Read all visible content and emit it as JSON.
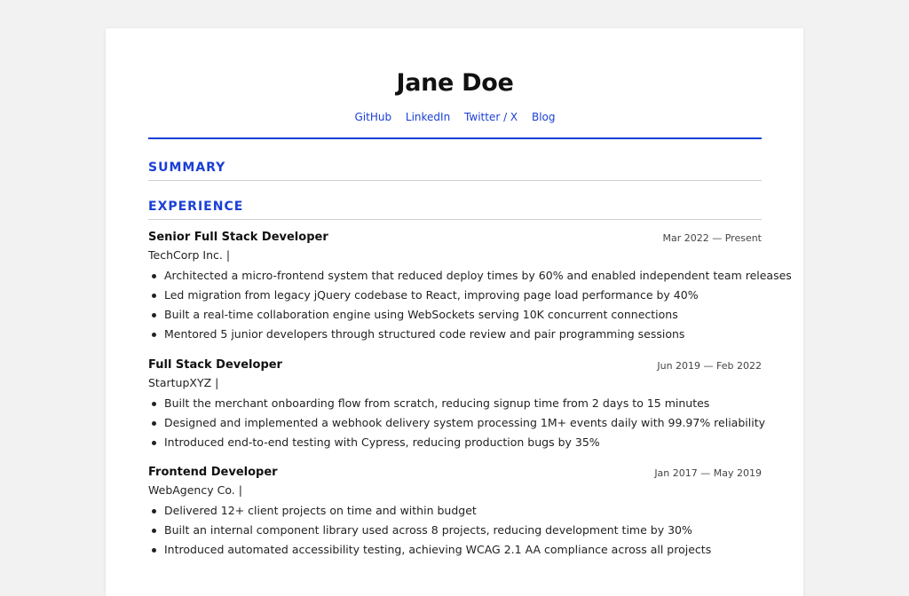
{
  "header": {
    "name": "Jane Doe",
    "links": [
      "GitHub",
      "LinkedIn",
      "Twitter / X",
      "Blog"
    ]
  },
  "sections": {
    "summary": "SUMMARY",
    "experience": "EXPERIENCE"
  },
  "jobs": [
    {
      "title": "Senior Full Stack Developer",
      "company": "TechCorp Inc. |",
      "dates": "Mar 2022 — Present",
      "bullets": [
        "Architected a micro-frontend system that reduced deploy times by 60% and enabled independent team releases",
        "Led migration from legacy jQuery codebase to React, improving page load performance by 40%",
        "Built a real-time collaboration engine using WebSockets serving 10K concurrent connections",
        "Mentored 5 junior developers through structured code review and pair programming sessions"
      ]
    },
    {
      "title": "Full Stack Developer",
      "company": "StartupXYZ |",
      "dates": "Jun 2019 — Feb 2022",
      "bullets": [
        "Built the merchant onboarding flow from scratch, reducing signup time from 2 days to 15 minutes",
        "Designed and implemented a webhook delivery system processing 1M+ events daily with 99.97% reliability",
        "Introduced end-to-end testing with Cypress, reducing production bugs by 35%"
      ]
    },
    {
      "title": "Frontend Developer",
      "company": "WebAgency Co. |",
      "dates": "Jan 2017 — May 2019",
      "bullets": [
        "Delivered 12+ client projects on time and within budget",
        "Built an internal component library used across 8 projects, reducing development time by 30%",
        "Introduced automated accessibility testing, achieving WCAG 2.1 AA compliance across all projects"
      ]
    }
  ],
  "colors": {
    "accent": "#1a3fd6",
    "background": "#f2f2f2",
    "paper": "#ffffff"
  }
}
